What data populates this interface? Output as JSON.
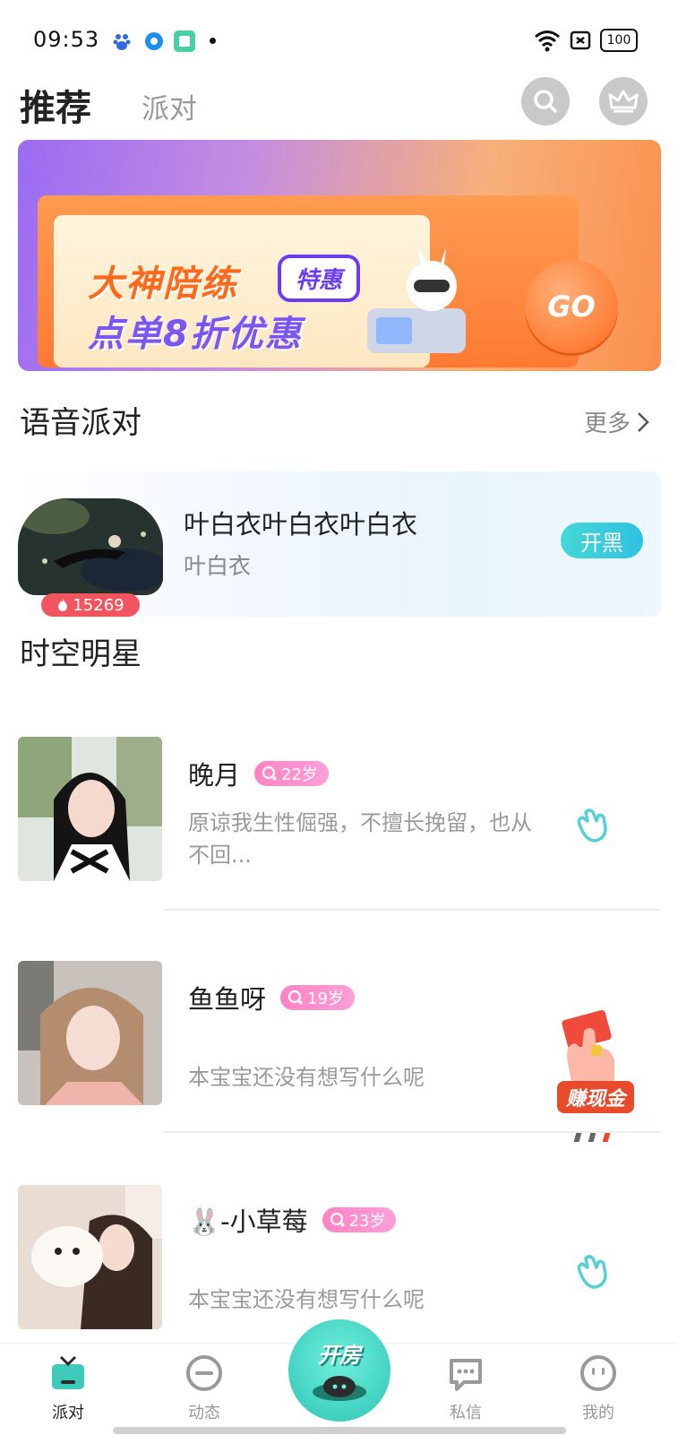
{
  "status_bar": {
    "time": "09:53",
    "battery": "100",
    "icons": [
      "baidu-icon",
      "browser-icon",
      "reader-icon",
      "wifi-icon",
      "sim-icon",
      "battery-icon"
    ]
  },
  "header": {
    "active_tab": "推荐",
    "inactive_tab": "派对"
  },
  "banner": {
    "line1": "大神陪练",
    "badge": "特惠",
    "line2": "点单8折优惠",
    "go": "GO"
  },
  "voice_party": {
    "title": "语音派对",
    "more": "更多",
    "room": {
      "name": "叶白衣叶白衣叶白衣",
      "host": "叶白衣",
      "heat": "15269",
      "action": "开黑"
    }
  },
  "stars": {
    "title": "时空明星",
    "users": [
      {
        "name": "晚月",
        "age": "22岁",
        "bio": "原谅我生性倔强，不擅长挽留，也从不回..."
      },
      {
        "name": "鱼鱼呀",
        "age": "19岁",
        "bio": "本宝宝还没有想写什么呢"
      },
      {
        "name": "🐰-小草莓",
        "age": "23岁",
        "bio": "本宝宝还没有想写什么呢"
      }
    ]
  },
  "float_earn": "赚现金",
  "nav": {
    "items": [
      {
        "label": "派对"
      },
      {
        "label": "动态"
      },
      {
        "label": "开房"
      },
      {
        "label": "私信"
      },
      {
        "label": "我的"
      }
    ]
  },
  "colors": {
    "accent_teal": "#2ec4b6",
    "heat_red": "#f2555e",
    "age_pink": "#ff83c3"
  }
}
